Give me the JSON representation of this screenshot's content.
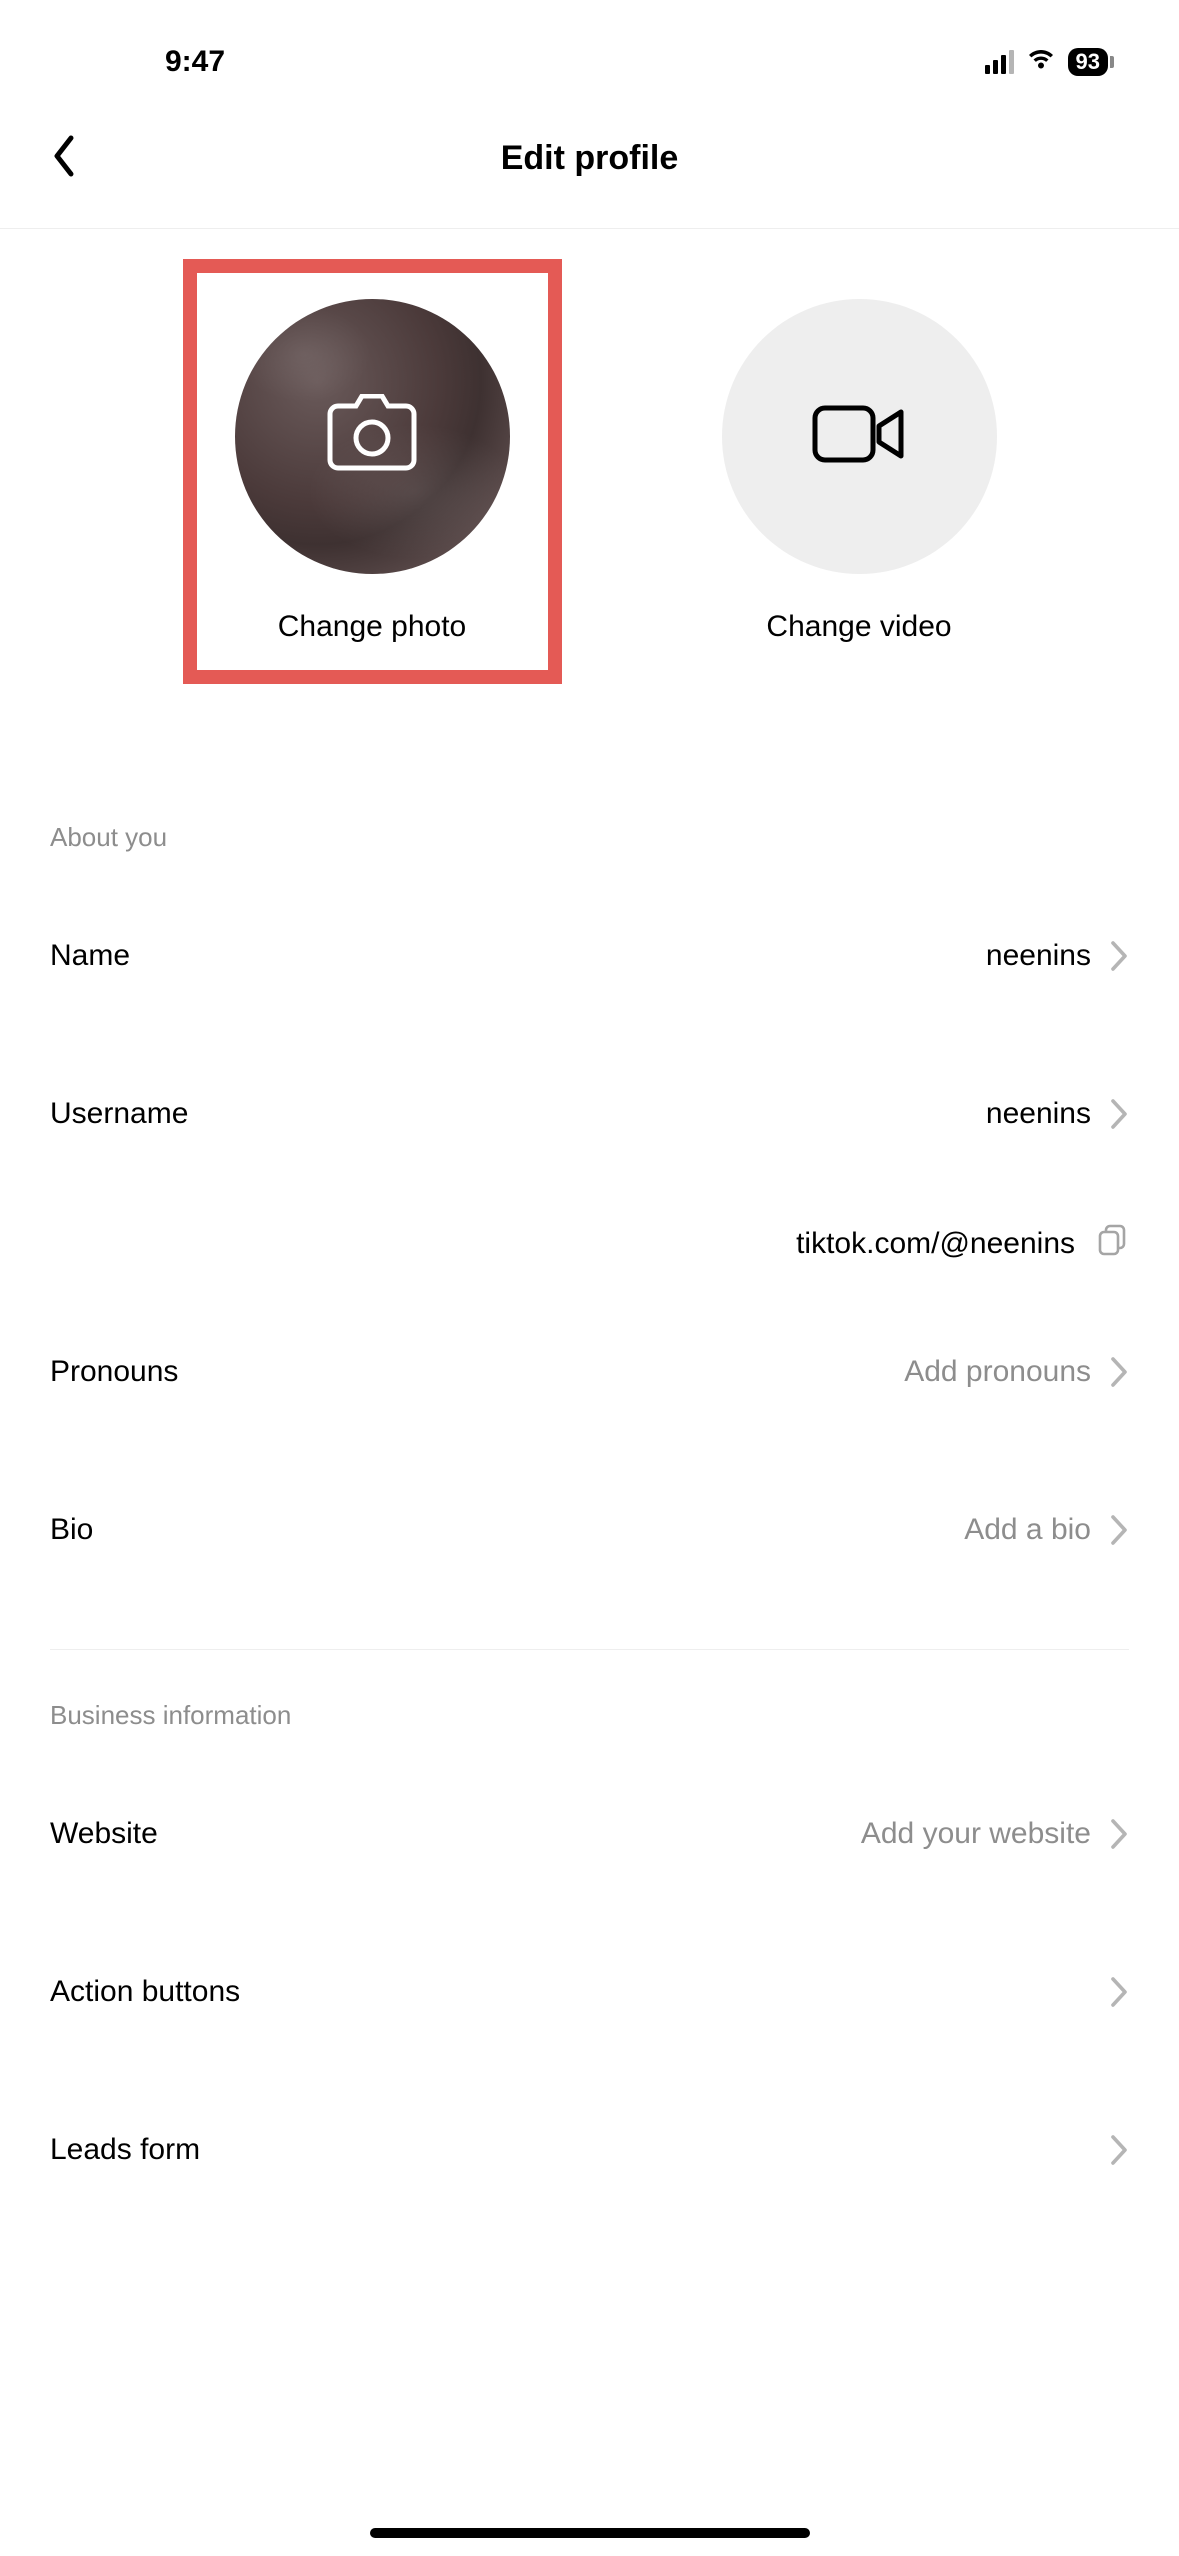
{
  "status": {
    "time": "9:47",
    "battery": "93"
  },
  "header": {
    "title": "Edit profile"
  },
  "media": {
    "change_photo": "Change photo",
    "change_video": "Change video"
  },
  "sections": {
    "about": {
      "title": "About you"
    },
    "business": {
      "title": "Business information"
    }
  },
  "about_rows": {
    "name": {
      "label": "Name",
      "value": "neenins",
      "muted": false
    },
    "username": {
      "label": "Username",
      "value": "neenins",
      "muted": false
    },
    "pronouns": {
      "label": "Pronouns",
      "value": "Add pronouns",
      "muted": true
    },
    "bio": {
      "label": "Bio",
      "value": "Add a bio",
      "muted": true
    }
  },
  "profile_url": "tiktok.com/@neenins",
  "business_rows": {
    "website": {
      "label": "Website",
      "value": "Add your website",
      "muted": true
    },
    "action_buttons": {
      "label": "Action buttons",
      "value": "",
      "muted": true
    },
    "leads_form": {
      "label": "Leads form",
      "value": "",
      "muted": true
    }
  }
}
